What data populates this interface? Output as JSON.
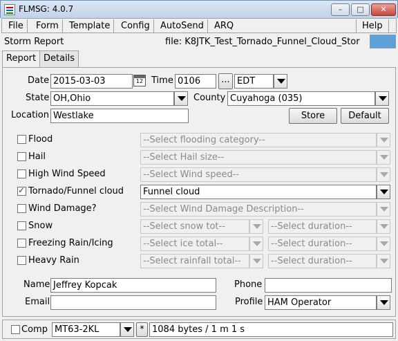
{
  "window": {
    "title": "FLMSG: 4.0.7",
    "min_glyph": "–",
    "max_glyph": "□",
    "close_glyph": "✕"
  },
  "menu": {
    "items": [
      "File",
      "Form",
      "Template",
      "Config",
      "AutoSend",
      "ARQ"
    ],
    "help": "Help"
  },
  "header": {
    "form_title": "Storm Report",
    "file_label": "file: K8JTK_Test_Tornado_Funnel_Cloud_Stor",
    "swatch_color": "#5ca2d8"
  },
  "tabs": [
    "Report",
    "Details"
  ],
  "report": {
    "date_label": "Date",
    "date_value": "2015-03-03",
    "calendar_day": "12",
    "time_label": "Time",
    "time_value": "0106",
    "time_button": "...",
    "tz_value": "EDT",
    "state_label": "State",
    "state_value": "OH,Ohio",
    "county_label": "County",
    "county_value": "Cuyahoga  (035)",
    "location_label": "Location",
    "location_value": "Westlake",
    "store_label": "Store",
    "default_label": "Default"
  },
  "events": [
    {
      "label": "Flood",
      "checked": false,
      "select1": "--Select flooding category--"
    },
    {
      "label": "Hail",
      "checked": false,
      "select1": "--Select Hail size--"
    },
    {
      "label": "High Wind Speed",
      "checked": false,
      "select1": "--Select Wind speed--"
    },
    {
      "label": "Tornado/Funnel cloud",
      "checked": true,
      "select1": "Funnel cloud"
    },
    {
      "label": "Wind Damage?",
      "checked": false,
      "select1": "--Select Wind Damage Description--"
    },
    {
      "label": "Snow",
      "checked": false,
      "select1": "--Select snow tot--",
      "select2": "--Select duration--"
    },
    {
      "label": "Freezing Rain/Icing",
      "checked": false,
      "select1": "--Select ice total--",
      "select2": "--Select duration--"
    },
    {
      "label": "Heavy Rain",
      "checked": false,
      "select1": "--Select rainfall total--",
      "select2": "--Select duration--"
    }
  ],
  "contact": {
    "name_label": "Name",
    "name_value": "Jeffrey Kopcak",
    "phone_label": "Phone",
    "phone_value": "",
    "email_label": "Email",
    "email_value": "",
    "profile_label": "Profile",
    "profile_value": "HAM Operator"
  },
  "bottom": {
    "comp_label": "Comp",
    "modem_value": "MT63-2KL",
    "star_label": "*",
    "size_text": "1084 bytes / 1 m 1 s"
  }
}
